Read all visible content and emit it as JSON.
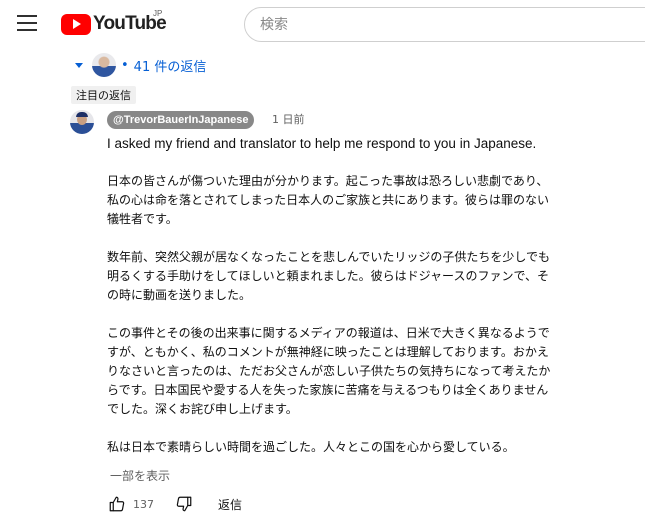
{
  "header": {
    "logo_text": "YouTube",
    "region": "JP",
    "search_placeholder": "検索"
  },
  "thread": {
    "replies_label": "41 件の返信",
    "pinned_label": "注目の返信"
  },
  "comment": {
    "author": "@TrevorBauerInJapanese",
    "timestamp": "1 日前",
    "lines": {
      "l1": "I asked my friend and translator to help me respond to you in Japanese.",
      "l2": "日本の皆さんが傷ついた理由が分かります。起こった事故は恐ろしい悲劇であり、",
      "l3": "私の心は命を落とされてしまった日本人のご家族と共にあります。彼らは罪のない",
      "l4": "犠牲者です。",
      "l5": "数年前、突然父親が居なくなったことを悲しんでいたリッジの子供たちを少しでも",
      "l6": "明るくする手助けをしてほしいと頼まれました。彼らはドジャースのファンで、そ",
      "l7": "の時に動画を送りました。",
      "l8": "この事件とその後の出来事に関するメディアの報道は、日米で大きく異なるようで",
      "l9": "すが、ともかく、私のコメントが無神経に映ったことは理解しております。おかえ",
      "l10": "りなさいと言ったのは、ただお父さんが恋しい子供たちの気持ちになって考えたか",
      "l11": "らです。日本国民や愛する人を失った家族に苦痛を与えるつもりは全くありません",
      "l12": "でした。深くお詫び申し上げます。",
      "l13": "私は日本で素晴らしい時間を過ごした。人々とこの国を心から愛している。"
    },
    "read_more": "一部を表示",
    "like_count": "137",
    "reply_label": "返信"
  },
  "icons": {
    "menu": "hamburger-icon",
    "like": "thumbs-up-icon",
    "dislike": "thumbs-down-icon",
    "expand": "caret-down-icon"
  },
  "colors": {
    "brand_red": "#ff0000",
    "link_blue": "#065fd4",
    "author_badge_bg": "#888888",
    "secondary_text": "#606060"
  }
}
